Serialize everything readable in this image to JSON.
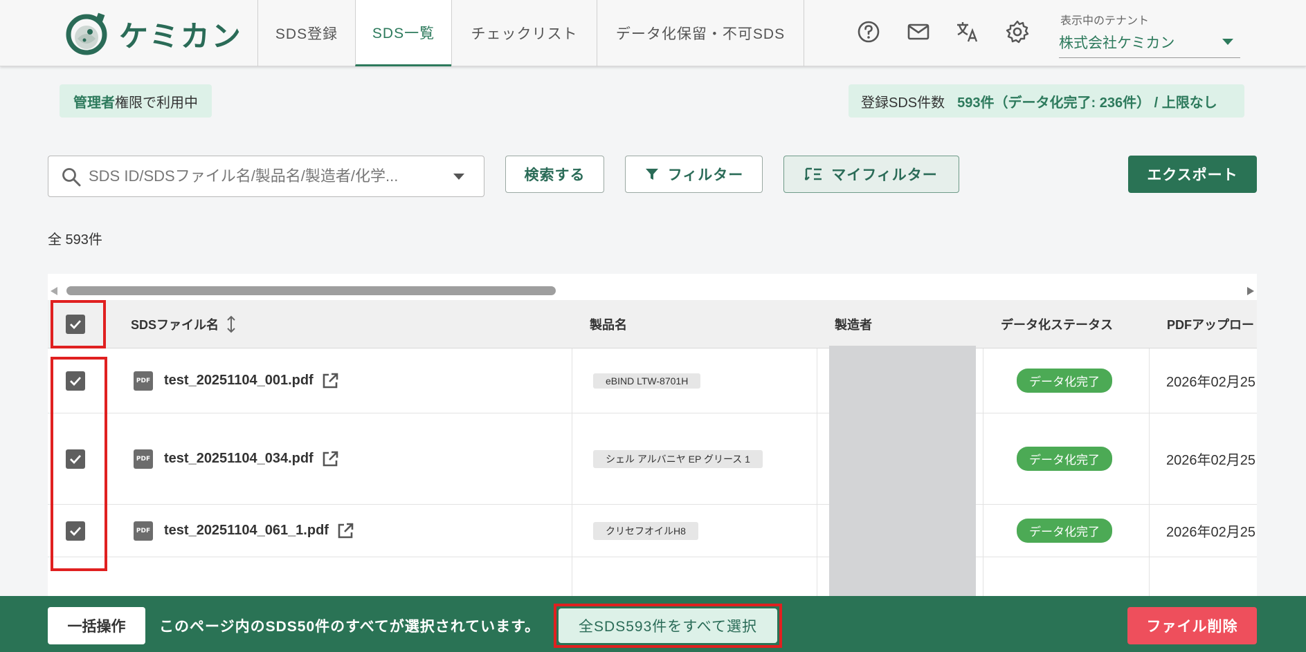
{
  "app": {
    "name": "ケミカン"
  },
  "nav": {
    "tabs": [
      {
        "label": "SDS登録"
      },
      {
        "label": "SDS一覧"
      },
      {
        "label": "チェックリスト"
      },
      {
        "label": "データ化保留・不可SDS"
      }
    ]
  },
  "tenant": {
    "label": "表示中のテナント",
    "value": "株式会社ケミカン"
  },
  "admin_badge": {
    "strong": "管理者",
    "rest": "権限で利用中"
  },
  "count_badge": {
    "label": "登録SDS件数",
    "value": "593件（データ化完了: 236件） / 上限なし"
  },
  "search": {
    "placeholder": "SDS ID/SDSファイル名/製品名/製造者/化学..."
  },
  "toolbar": {
    "search_label": "検索する",
    "filter_label": "フィルター",
    "myfilter_label": "マイフィルター",
    "export_label": "エクスポート"
  },
  "total_count": "全 593件",
  "table": {
    "headers": {
      "filename": "SDSファイル名",
      "product": "製品名",
      "maker": "製造者",
      "status": "データ化ステータス",
      "upload": "PDFアップロード"
    },
    "rows": [
      {
        "filename": "test_20251104_001.pdf",
        "product": "eBIND LTW-8701H",
        "status": "データ化完了",
        "date": "2026年02月25"
      },
      {
        "filename": "test_20251104_034.pdf",
        "product": "シェル アルバニヤ EP グリース 1",
        "status": "データ化完了",
        "date": "2026年02月25"
      },
      {
        "filename": "test_20251104_061_1.pdf",
        "product": "クリセフオイルH8",
        "status": "データ化完了",
        "date": "2026年02月25"
      }
    ]
  },
  "bottom": {
    "bulk_label": "一括操作",
    "message": "このページ内のSDS50件のすべてが選択されています。",
    "select_all_label": "全SDS593件をすべて選択",
    "delete_label": "ファイル削除"
  },
  "colors": {
    "brand": "#2a7355",
    "accent_text": "#2d7a5c",
    "status_done": "#4caa55",
    "danger": "#ee4f5c",
    "highlight": "#e02020"
  }
}
